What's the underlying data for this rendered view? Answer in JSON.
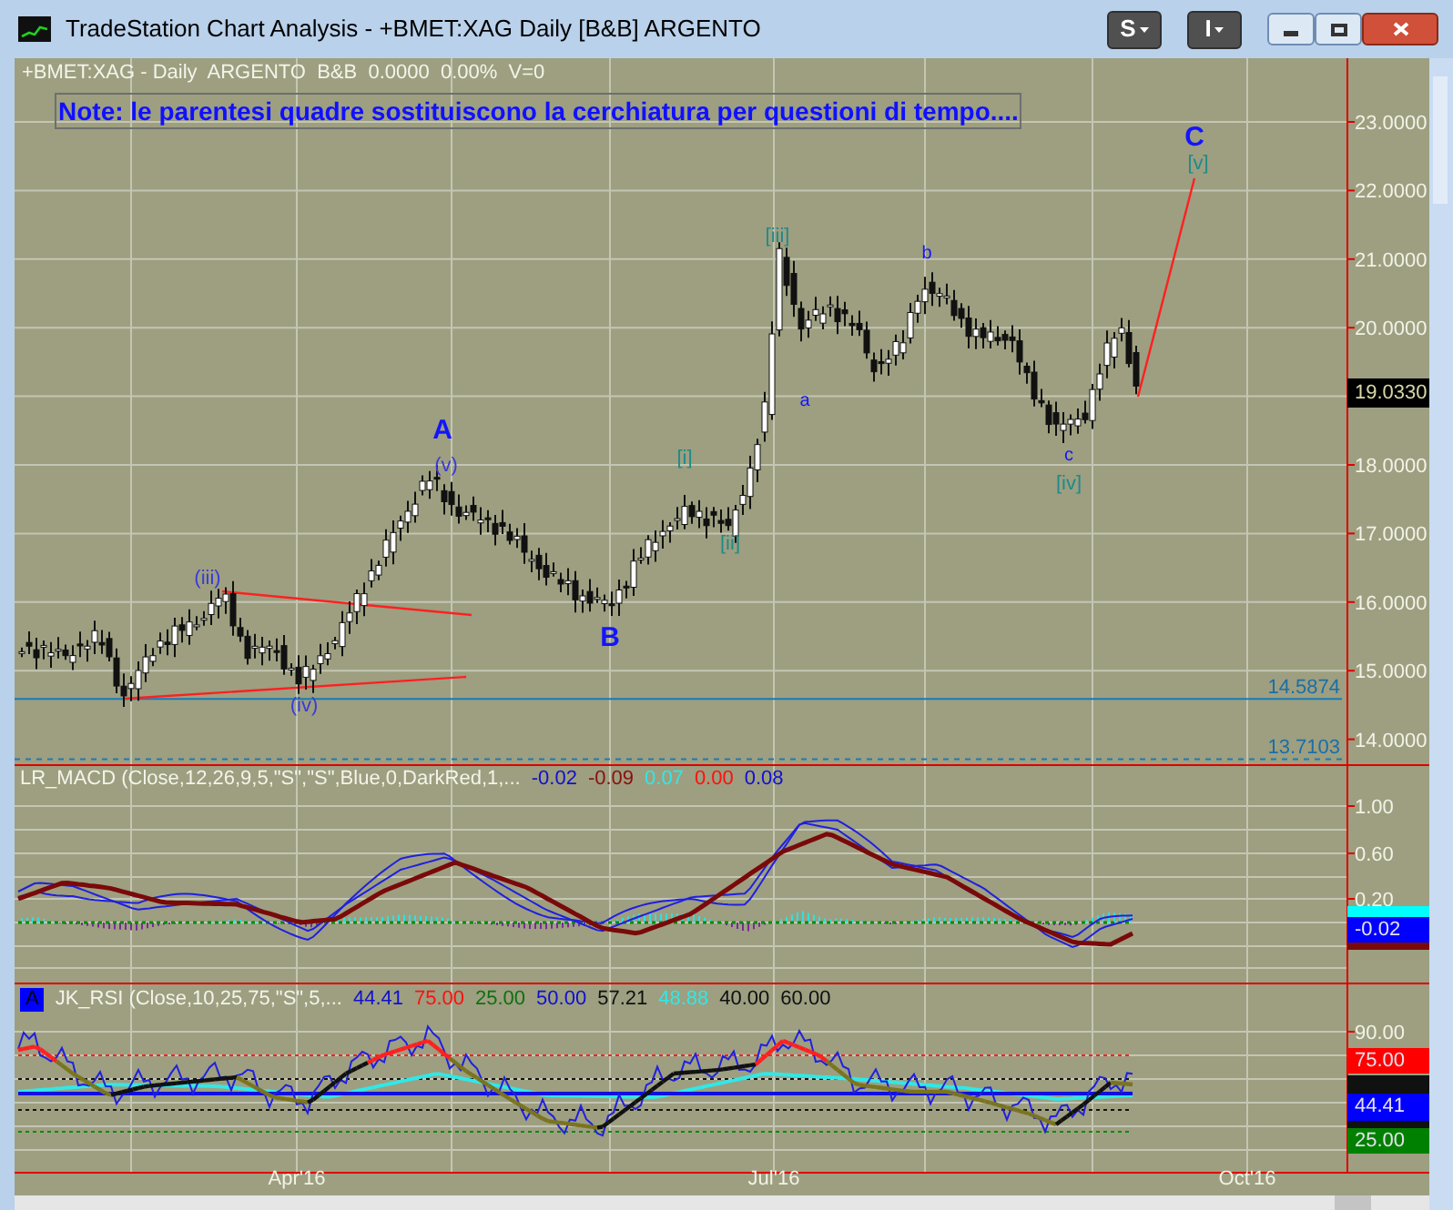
{
  "window": {
    "title": "TradeStation Chart Analysis - +BMET:XAG Daily [B&B] ARGENTO"
  },
  "toolbar_buttons": [
    {
      "label": "S"
    },
    {
      "label": "I"
    }
  ],
  "chart": {
    "header": "+BMET:XAG - Daily  ARGENTO  B&B  0.0000  0.00%  V=0",
    "note": "Note: le parentesi quadre sostituiscono la cerchiatura per questioni di tempo....",
    "y_ticks": [
      "23.0000",
      "22.0000",
      "21.0000",
      "20.0000",
      "18.0000",
      "17.0000",
      "16.0000",
      "15.0000",
      "14.0000"
    ],
    "last_price": "19.0330",
    "reference_lines": [
      {
        "label": "14.5874",
        "kind": "solid"
      },
      {
        "label": "13.7103",
        "kind": "dashed"
      }
    ],
    "wave_labels": [
      {
        "text": "A",
        "kind": "primary",
        "color": "#1414ff"
      },
      {
        "text": "(v)",
        "kind": "intermediate",
        "color": "#3a3ad8"
      },
      {
        "text": "(iii)",
        "kind": "intermediate",
        "color": "#3a3ad8"
      },
      {
        "text": "(iv)",
        "kind": "intermediate",
        "color": "#3a3ad8"
      },
      {
        "text": "B",
        "kind": "primary",
        "color": "#1414ff"
      },
      {
        "text": "[i]",
        "kind": "intermediate",
        "color": "#1f8a8a"
      },
      {
        "text": "[ii]",
        "kind": "intermediate",
        "color": "#1f8a8a"
      },
      {
        "text": "[iii]",
        "kind": "intermediate",
        "color": "#1f8a8a"
      },
      {
        "text": "a",
        "kind": "minor",
        "color": "#1414ff"
      },
      {
        "text": "b",
        "kind": "minor",
        "color": "#1414ff"
      },
      {
        "text": "c",
        "kind": "minor",
        "color": "#1414ff"
      },
      {
        "text": "[iv]",
        "kind": "intermediate",
        "color": "#1f8a8a"
      },
      {
        "text": "C",
        "kind": "primary",
        "color": "#1414ff"
      },
      {
        "text": "[v]",
        "kind": "intermediate",
        "color": "#1f8a8a"
      }
    ]
  },
  "macd": {
    "title": "LR_MACD (Close,12,26,9,5,\"S\",\"S\",Blue,0,DarkRed,1,...",
    "values": [
      {
        "text": "-0.02",
        "color": "#1010d0"
      },
      {
        "text": "-0.09",
        "color": "#8b1010"
      },
      {
        "text": "0.07",
        "color": "#30e8e8"
      },
      {
        "text": "0.00",
        "color": "#ff1010"
      },
      {
        "text": "0.08",
        "color": "#1010d0"
      }
    ],
    "y_ticks": [
      "1.00",
      "0.60",
      "0.20"
    ],
    "axis_badges": [
      {
        "text": "-0.02",
        "color": "#0000ff"
      }
    ]
  },
  "rsi": {
    "badge": "A",
    "title": "JK_RSI (Close,10,25,75,\"S\",5,...",
    "values": [
      {
        "text": "44.41",
        "color": "#1010d0"
      },
      {
        "text": "75.00",
        "color": "#ff1010"
      },
      {
        "text": "25.00",
        "color": "#107010"
      },
      {
        "text": "50.00",
        "color": "#1010d0"
      },
      {
        "text": "57.21",
        "color": "#101010"
      },
      {
        "text": "48.88",
        "color": "#30e8e8"
      },
      {
        "text": "40.00",
        "color": "#101010"
      },
      {
        "text": "60.00",
        "color": "#101010"
      }
    ],
    "y_ticks": [
      "90.00"
    ],
    "axis_badges": [
      {
        "text": "75.00",
        "color": "#ff0000"
      },
      {
        "text": "44.41",
        "color": "#0000ff"
      },
      {
        "text": "25.00",
        "color": "#008000"
      }
    ]
  },
  "x_axis": {
    "labels": [
      "Apr'16",
      "Jul'16",
      "Oct'16"
    ]
  }
}
